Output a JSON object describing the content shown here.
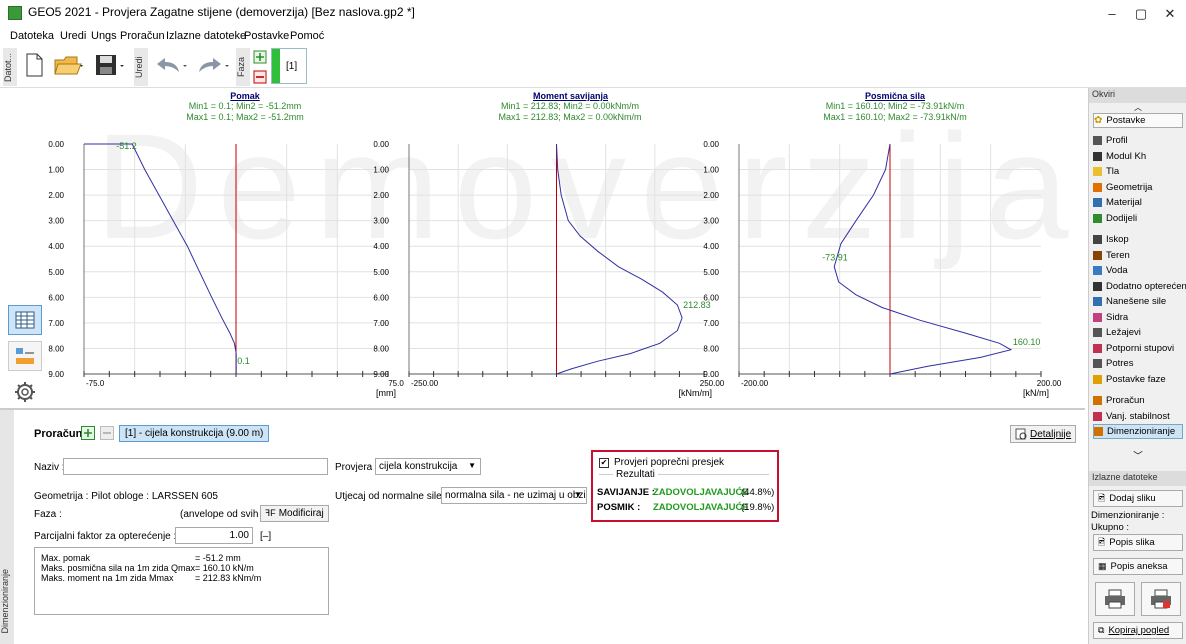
{
  "window": {
    "title": "GEO5 2021 - Provjera Zagatne stijene (demoverzija) [Bez naslova.gp2 *]",
    "minimize": "–",
    "maximize": "▢",
    "close": "✕"
  },
  "menu": [
    "Datoteka",
    "Uredi",
    "Ungs",
    "Proračun",
    "Izlazne datoteke",
    "Postavke",
    "Pomoć"
  ],
  "toolbar": {
    "datot_label": "Datot...",
    "uredi_label": "Uredi",
    "faza_label": "Faza",
    "stage_value": "[1]"
  },
  "watermark": "Demoverzija",
  "charts": [
    {
      "title": "Pomak",
      "subtitle1": "Min1 = 0.1; Min2 = -51.2mm",
      "subtitle2": "Max1 = 0.1; Max2 = -51.2mm",
      "unit": "[mm]",
      "x_min_label": "-75.0",
      "x_max_label": "75.0",
      "top_label": "-51.2",
      "bottom_label": "0.1"
    },
    {
      "title": "Moment savijanja",
      "subtitle1": "Min1 = 212.83; Min2 = 0.00kNm/m",
      "subtitle2": "Max1 = 212.83; Max2 = 0.00kNm/m",
      "unit": "[kNm/m]",
      "x_min_label": "-250.00",
      "x_max_label": "250.00",
      "peak_label": "212.83"
    },
    {
      "title": "Posmična sila",
      "subtitle1": "Min1 = 160.10; Min2 = -73.91kN/m",
      "subtitle2": "Max1 = 160.10; Max2 = -73.91kN/m",
      "unit": "[kN/m]",
      "x_min_label": "-200.00",
      "x_max_label": "200.00",
      "min_label": "-73.91",
      "max_label": "160.10"
    }
  ],
  "depth_ticks": [
    "0.00",
    "1.00",
    "2.00",
    "3.00",
    "4.00",
    "5.00",
    "6.00",
    "7.00",
    "8.00",
    "9.00"
  ],
  "chart_data": [
    {
      "type": "line",
      "title": "Pomak",
      "xlabel": "[mm]",
      "ylabel": "",
      "xlim": [
        -75,
        75
      ],
      "ylim": [
        0,
        9
      ],
      "y_inverted": true,
      "series": [
        {
          "x": [
            -75,
            -51.2,
            -45,
            -38,
            -31,
            -24,
            -18,
            -12,
            -7,
            -3,
            -0.8,
            0.1,
            0.1
          ],
          "y": [
            0,
            0,
            1,
            2,
            3,
            4,
            5,
            6,
            6.8,
            7.4,
            7.8,
            8.2,
            9
          ]
        }
      ]
    },
    {
      "type": "line",
      "title": "Moment savijanja",
      "xlabel": "[kNm/m]",
      "ylabel": "",
      "xlim": [
        -250,
        250
      ],
      "ylim": [
        0,
        9
      ],
      "y_inverted": true,
      "series": [
        {
          "x": [
            0,
            2,
            8,
            20,
            40,
            70,
            105,
            145,
            180,
            205,
            212.83,
            205,
            175,
            125,
            70,
            25,
            0
          ],
          "y": [
            0,
            1,
            2,
            3,
            3.6,
            4.2,
            4.8,
            5.3,
            5.8,
            6.3,
            6.8,
            7.3,
            7.8,
            8.2,
            8.5,
            8.8,
            9
          ]
        }
      ]
    },
    {
      "type": "line",
      "title": "Posmična sila",
      "xlabel": "[kN/m]",
      "ylabel": "",
      "xlim": [
        -200,
        200
      ],
      "ylim": [
        0,
        9
      ],
      "y_inverted": true,
      "series": [
        {
          "x": [
            0,
            -6,
            -22,
            -45,
            -65,
            -73.91,
            -68,
            -45,
            -10,
            40,
            100,
            145,
            160.1,
            120,
            50,
            0
          ],
          "y": [
            0,
            1,
            2,
            3,
            3.9,
            4.8,
            5.4,
            5.9,
            6.4,
            6.9,
            7.4,
            7.8,
            8.05,
            8.35,
            8.7,
            9
          ]
        }
      ]
    }
  ],
  "bottom": {
    "proracun_label": "Proračun :",
    "stage_tab": "[1] - cijela konstrukcija (9.00 m)",
    "detaljnije": "Detaljnije",
    "naziv_label": "Naziv :",
    "naziv_value": "",
    "provjera_label": "Provjera :",
    "provjera_value": "cijela konstrukcija",
    "geometrija": "Geometrija : Pilot obloge : LARSSEN 605",
    "utjecaj_label": "Utjecaj od normalne sile :",
    "utjecaj_value": "normalna sila - ne uzimaj u obzir",
    "faza_label": "Faza :",
    "faza_value": "(anvelope od svih faza)",
    "modificiraj": "Modificiraj",
    "parcijalni_label": "Parcijalni faktor za opterećenje :",
    "parcijalni_value": "1.00",
    "parcijalni_unit": "[–]",
    "summary_lines": [
      {
        "label": "Max. pomak",
        "value": "=   -51.2  mm"
      },
      {
        "label": "Maks. posmična sila na 1m zida  Qmax",
        "value": "=  160.10  kN/m"
      },
      {
        "label": "Maks. moment na 1m zida      Mmax",
        "value": "=  212.83  kNm/m"
      }
    ],
    "side_label": "Dimenzioniranje"
  },
  "results": {
    "checkbox_label": "Provjeri poprečni presjek",
    "checked": true,
    "header": "Rezultati",
    "savijanje_label": "SAVIJANJE :",
    "savijanje_value": "ZADOVOLJAVAJUĆE",
    "savijanje_pct": "(44.8%)",
    "posmik_label": "POSMIK :",
    "posmik_value": "ZADOVOLJAVAJUĆE",
    "posmik_pct": "(19.8%)"
  },
  "right_panel": {
    "okviri_header": "Okviri",
    "postavke": "Postavke",
    "items": [
      "Profil",
      "Modul Kh",
      "Tla",
      "Geometrija",
      "Materijal",
      "Dodijeli",
      "Iskop",
      "Teren",
      "Voda",
      "Dodatno opterećenje",
      "Nanešene sile",
      "Sidra",
      "Ležajevi",
      "Potporni stupovi",
      "Potres",
      "Postavke faze",
      "Proračun",
      "Vanj. stabilnost",
      "Dimenzioniranje"
    ],
    "izlazne_header": "Izlazne datoteke",
    "dodaj_sliku": "Dodaj sliku",
    "dimenzioniranje_label": "Dimenzioniranje :",
    "ukupno_label": "Ukupno :",
    "popis_slika": "Popis slika",
    "popis_aneksa": "Popis aneksa",
    "kopiraj": "Kopiraj pogled"
  },
  "colors": {
    "curve": "#3030a0",
    "red_line": "#c00000",
    "green_text": "#2e8b2e",
    "result_green": "#1f9b1f",
    "results_border": "#c8102e",
    "selected_item_bg": "#cde4f7"
  }
}
